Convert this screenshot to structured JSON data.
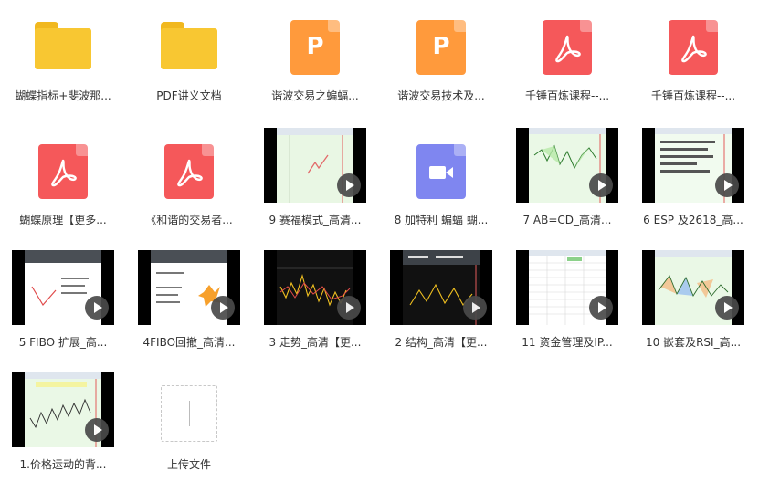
{
  "files": [
    {
      "label": "蝴蝶指标+斐波那...",
      "kind": "folder"
    },
    {
      "label": "PDF讲义文档",
      "kind": "folder"
    },
    {
      "label": "谐波交易之蝙蝠...",
      "kind": "ppt",
      "glyph": "P"
    },
    {
      "label": "谐波交易技术及...",
      "kind": "ppt",
      "glyph": "P"
    },
    {
      "label": "千锤百炼课程--...",
      "kind": "pdf"
    },
    {
      "label": "千锤百炼课程--...",
      "kind": "pdf"
    },
    {
      "label": "蝴蝶原理【更多...",
      "kind": "pdf"
    },
    {
      "label": "《和谐的交易者...",
      "kind": "pdf"
    },
    {
      "label": "9 赛福模式_高清...",
      "kind": "video",
      "theme": "light-green"
    },
    {
      "label": "8 加特利 蝙蝠 蝴...",
      "kind": "video-file"
    },
    {
      "label": "7 AB=CD_高清...",
      "kind": "video",
      "theme": "green-chart"
    },
    {
      "label": "6 ESP 及2618_高...",
      "kind": "video",
      "theme": "text-green"
    },
    {
      "label": "5 FIBO 扩展_高...",
      "kind": "video",
      "theme": "slide-red"
    },
    {
      "label": "4FIBO回撤_高清...",
      "kind": "video",
      "theme": "slide-orange"
    },
    {
      "label": "3 走势_高清【更...",
      "kind": "video",
      "theme": "dark-candles"
    },
    {
      "label": "2 结构_高清【更...",
      "kind": "video",
      "theme": "dark-slide"
    },
    {
      "label": "11 资金管理及IP...",
      "kind": "video",
      "theme": "spreadsheet"
    },
    {
      "label": "10 嵌套及RSI_高...",
      "kind": "video",
      "theme": "pattern"
    },
    {
      "label": "1.价格运动的背...",
      "kind": "video",
      "theme": "green-candles"
    }
  ],
  "upload": {
    "label": "上传文件"
  },
  "colors": {
    "folder": "#f8c732",
    "ppt": "#ff9a3c",
    "pdf": "#f5585a",
    "video_file": "#7f86f0"
  }
}
